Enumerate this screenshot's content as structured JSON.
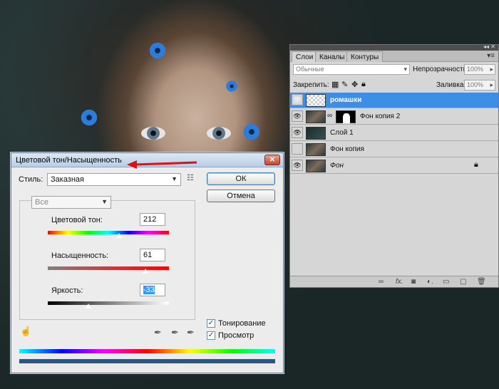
{
  "dialog": {
    "title": "Цветовой тон/Насыщенность",
    "style_label": "Стиль:",
    "style_value": "Заказная",
    "ok_label": "ОК",
    "cancel_label": "Отмена",
    "channel_value": "Все",
    "hue_label": "Цветовой тон:",
    "hue_value": "212",
    "hue_level": 212,
    "saturation_label": "Насыщенность:",
    "saturation_value": "61",
    "saturation_level": 61,
    "lightness_label": "Яркость:",
    "lightness_value": "-33",
    "lightness_level": -33,
    "colorize_label": "Тонирование",
    "colorize_checked": true,
    "preview_label": "Просмотр",
    "preview_checked": true
  },
  "layers_panel": {
    "tabs": [
      "Слои",
      "Каналы",
      "Контуры"
    ],
    "active_tab": "Слои",
    "blend_mode": "Обычные",
    "opacity_label": "Непрозрачность:",
    "opacity_value": "100%",
    "lock_label": "Закрепить:",
    "fill_label": "Заливка:",
    "fill_value": "100%",
    "layers": [
      {
        "name": "ромашки",
        "visible": true,
        "selected": true,
        "thumb": "transparent"
      },
      {
        "name": "Фон копия 2",
        "visible": true,
        "selected": false,
        "thumb": "photo",
        "has_mask": true
      },
      {
        "name": "Слой 1",
        "visible": true,
        "selected": false,
        "thumb": "dark"
      },
      {
        "name": "Фон копия",
        "visible": false,
        "selected": false,
        "thumb": "photo"
      },
      {
        "name": "Фон",
        "visible": true,
        "selected": false,
        "thumb": "photo",
        "locked": true
      }
    ]
  },
  "colors": {
    "selected_layer": "#3d8ee6",
    "annotation_arrow": "#e01010"
  }
}
